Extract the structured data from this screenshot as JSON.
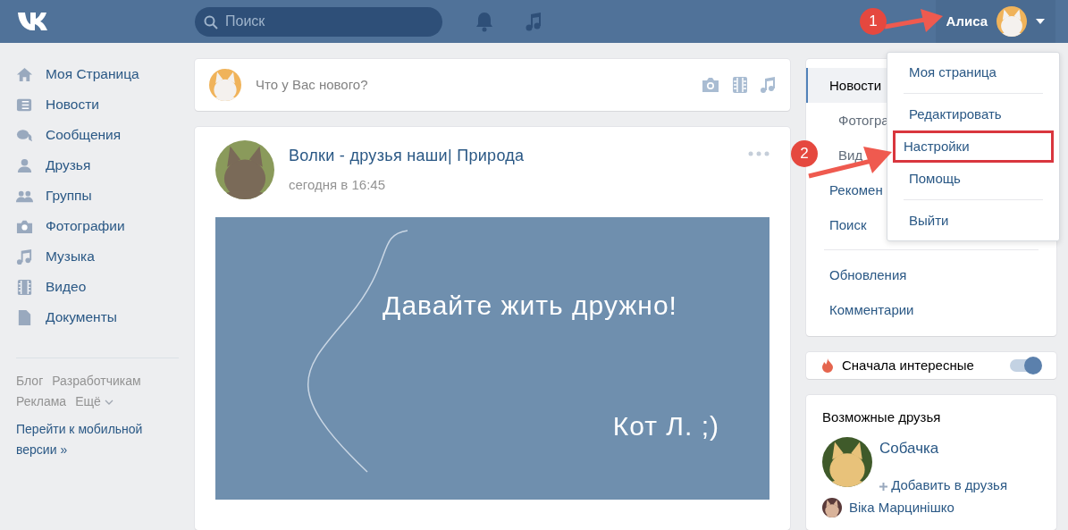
{
  "header": {
    "search": {
      "placeholder": "Поиск"
    },
    "user": {
      "name": "Алиса"
    }
  },
  "sidebar": {
    "items": [
      {
        "label": "Моя Страница"
      },
      {
        "label": "Новости"
      },
      {
        "label": "Сообщения"
      },
      {
        "label": "Друзья"
      },
      {
        "label": "Группы"
      },
      {
        "label": "Фотографии"
      },
      {
        "label": "Музыка"
      },
      {
        "label": "Видео"
      },
      {
        "label": "Документы"
      }
    ],
    "footer_links": [
      {
        "label": "Блог"
      },
      {
        "label": "Разработчикам"
      },
      {
        "label": "Реклама"
      },
      {
        "label": "Ещё",
        "kind": "more"
      }
    ],
    "mobile_link": "Перейти к мобильной версии »"
  },
  "composer": {
    "placeholder": "Что у Вас нового?"
  },
  "post": {
    "author": "Волки - друзья наши| Природа",
    "time": "сегодня в 16:45",
    "image_lines": [
      "Давайте жить дружно!",
      "Кот Л. ;)"
    ]
  },
  "news_menu": {
    "groups": [
      [
        {
          "label": "Новости",
          "kind": "main",
          "selected": true
        },
        {
          "label": "Фотогра",
          "kind": "sub",
          "selected": false
        },
        {
          "label": "Вид",
          "kind": "sub",
          "selected": false
        },
        {
          "label": "Рекомен",
          "kind": "main",
          "selected": false
        },
        {
          "label": "Поиск",
          "kind": "main",
          "selected": false
        }
      ],
      [
        {
          "label": "Обновления",
          "kind": "main",
          "selected": false
        },
        {
          "label": "Комментарии",
          "kind": "main",
          "selected": false
        }
      ]
    ]
  },
  "feed_option": {
    "label": "Сначала интересные",
    "on": true
  },
  "friends": {
    "title": "Возможные друзья",
    "people": [
      {
        "name": "Собачка",
        "action": "Добавить в друзья"
      },
      {
        "name": "Віка Марцинішко"
      }
    ]
  },
  "user_menu": {
    "groups": [
      [
        {
          "label": "Моя страница",
          "highlighted": false
        }
      ],
      [
        {
          "label": "Редактировать",
          "highlighted": false
        },
        {
          "label": "Настройки",
          "highlighted": true
        },
        {
          "label": "Помощь",
          "highlighted": false
        }
      ],
      [
        {
          "label": "Выйти",
          "highlighted": false
        }
      ]
    ]
  },
  "annotations": [
    {
      "number": "1"
    },
    {
      "number": "2"
    }
  ]
}
